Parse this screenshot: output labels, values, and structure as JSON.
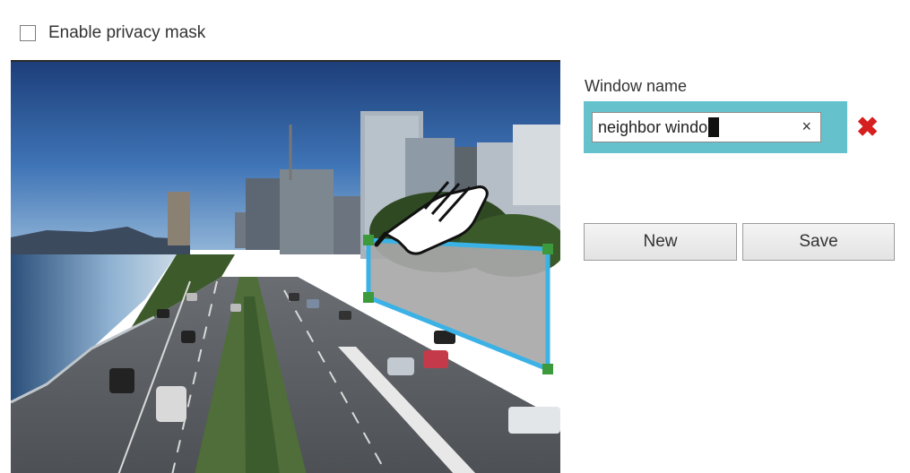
{
  "privacy": {
    "label": "Enable privacy mask",
    "checked": false
  },
  "video": {
    "alt": "camera view"
  },
  "window": {
    "label": "Window name",
    "value": "neighbor windo",
    "clear_glyph": "×",
    "delete_glyph": "✖"
  },
  "buttons": {
    "new_label": "New",
    "save_label": "Save"
  },
  "colors": {
    "accent": "#65c2cd",
    "mask_edge": "#3bb2e6",
    "handle": "#3c9a3c",
    "delete": "#d61f1f"
  },
  "icons": [
    "checkbox-icon",
    "clear-icon",
    "delete-icon",
    "hand-pointer-icon"
  ]
}
